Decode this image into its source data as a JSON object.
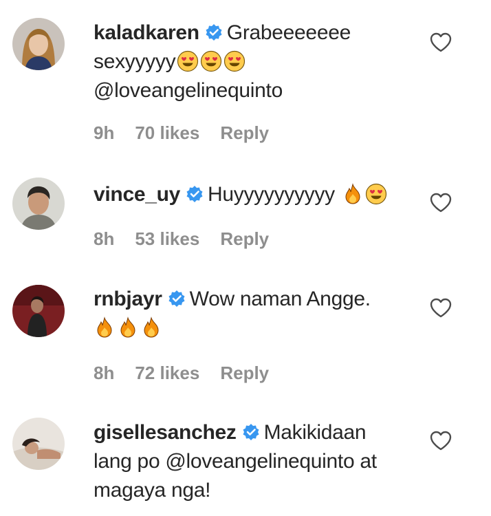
{
  "comments": [
    {
      "username": "kaladkaren",
      "text_lines": [
        "Grabeeeeeee",
        "sexyyyyy",
        "@loveangelinequinto"
      ],
      "emojis": [
        "heart-eyes-emoji",
        "heart-eyes-emoji",
        "heart-eyes-emoji"
      ],
      "time": "9h",
      "likes": "70 likes",
      "reply": "Reply"
    },
    {
      "username": "vince_uy",
      "text_lines": [
        "Huyyyyyyyyyy"
      ],
      "emojis": [
        "fire-emoji",
        "heart-eyes-emoji"
      ],
      "time": "8h",
      "likes": "53 likes",
      "reply": "Reply"
    },
    {
      "username": "rnbjayr",
      "text_lines": [
        "Wow naman Angge."
      ],
      "emojis": [
        "fire-emoji",
        "fire-emoji",
        "fire-emoji"
      ],
      "time": "8h",
      "likes": "72 likes",
      "reply": "Reply"
    },
    {
      "username": "gisellesanchez",
      "text_lines": [
        "Makikidaan",
        "lang po @loveangelinequinto at",
        "magaya nga!"
      ],
      "emojis": [],
      "time": "",
      "likes": "",
      "reply": ""
    }
  ],
  "colors": {
    "text": "#262626",
    "meta": "#8e8e8e",
    "verified": "#3897f0",
    "fire": "#f4900c",
    "emoji_face": "#ffcc4d",
    "heart_eyes": "#dd2e44"
  }
}
